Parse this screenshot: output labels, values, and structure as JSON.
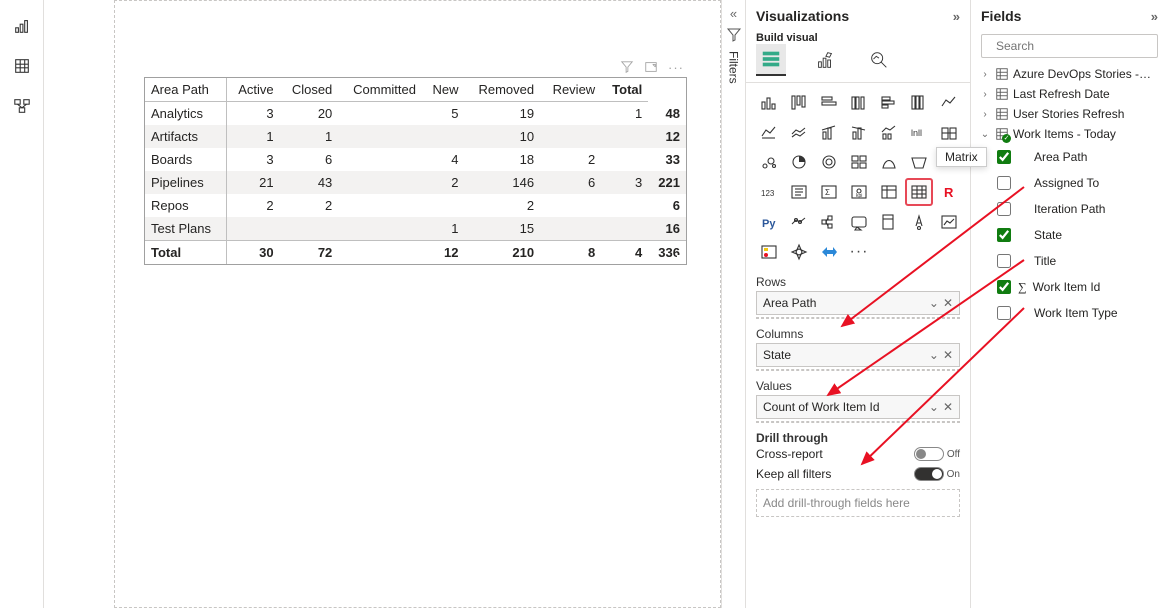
{
  "rail": {
    "tabs": [
      "chart",
      "table",
      "model"
    ]
  },
  "canvas": {
    "toolbar_icons": [
      "filter",
      "focus",
      "more"
    ],
    "matrix": {
      "row_header": "Area Path",
      "columns": [
        "Active",
        "Closed",
        "Committed",
        "New",
        "Removed",
        "Review",
        "Total"
      ],
      "rows": [
        {
          "label": "Analytics",
          "cells": [
            "3",
            "20",
            "",
            "5",
            "19",
            "",
            "1",
            "48"
          ]
        },
        {
          "label": "Artifacts",
          "cells": [
            "1",
            "1",
            "",
            "",
            "10",
            "",
            "",
            "12"
          ]
        },
        {
          "label": "Boards",
          "cells": [
            "3",
            "6",
            "",
            "4",
            "18",
            "2",
            "",
            "33"
          ]
        },
        {
          "label": "Pipelines",
          "cells": [
            "21",
            "43",
            "",
            "2",
            "146",
            "6",
            "3",
            "221"
          ]
        },
        {
          "label": "Repos",
          "cells": [
            "2",
            "2",
            "",
            "",
            "2",
            "",
            "",
            "6"
          ]
        },
        {
          "label": "Test Plans",
          "cells": [
            "",
            "",
            "",
            "1",
            "15",
            "",
            "",
            "16"
          ]
        }
      ],
      "total_row": {
        "label": "Total",
        "cells": [
          "30",
          "72",
          "",
          "12",
          "210",
          "8",
          "4",
          "336"
        ]
      }
    }
  },
  "filters_strip": {
    "collapse_icon": "«",
    "filter_label": "Filters"
  },
  "viz": {
    "title": "Visualizations",
    "collapse_icon": "»",
    "build_label": "Build visual",
    "gallery_tooltip": "Matrix",
    "wells": {
      "rows_label": "Rows",
      "rows_value": "Area Path",
      "cols_label": "Columns",
      "cols_value": "State",
      "vals_label": "Values",
      "vals_value": "Count of Work Item Id",
      "drill_label": "Drill through",
      "cross_report_label": "Cross-report",
      "cross_report_state": "Off",
      "keep_filters_label": "Keep all filters",
      "keep_filters_state": "On",
      "drill_placeholder": "Add drill-through fields here"
    }
  },
  "fields": {
    "title": "Fields",
    "collapse_icon": "»",
    "search_placeholder": "Search",
    "tables": [
      {
        "name": "Azure DevOps Stories -…",
        "expanded": false
      },
      {
        "name": "Last Refresh Date",
        "expanded": false
      },
      {
        "name": "User Stories Refresh",
        "expanded": false
      },
      {
        "name": "Work Items - Today",
        "expanded": true,
        "checked": true,
        "cols": [
          {
            "name": "Area Path",
            "checked": true
          },
          {
            "name": "Assigned To",
            "checked": false
          },
          {
            "name": "Iteration Path",
            "checked": false
          },
          {
            "name": "State",
            "checked": true
          },
          {
            "name": "Title",
            "checked": false
          },
          {
            "name": "Work Item Id",
            "checked": true,
            "sigma": true
          },
          {
            "name": "Work Item Type",
            "checked": false
          }
        ]
      }
    ]
  }
}
